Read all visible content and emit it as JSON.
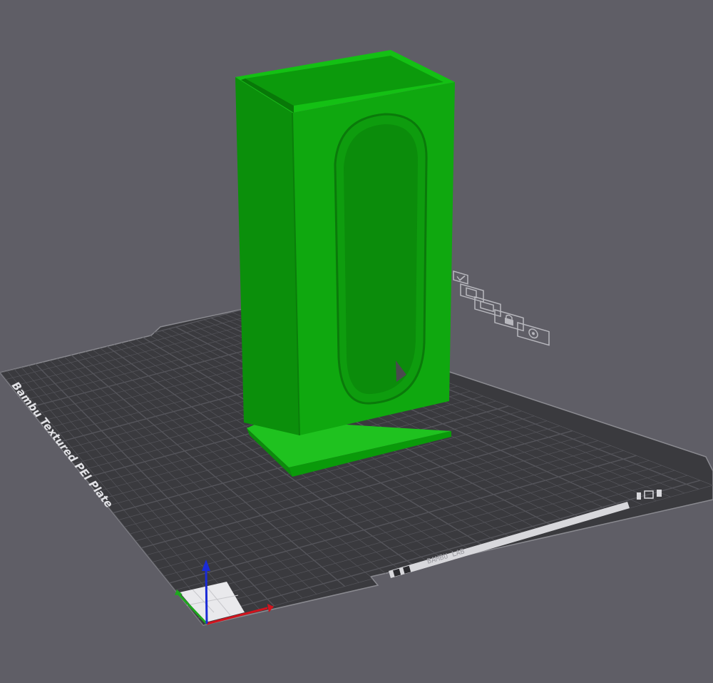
{
  "viewport": {
    "background_color": "#5f5e66",
    "plate": {
      "label": "Bambu Textured PEI Plate",
      "strip_text": "BAMBU LAB",
      "plate_color": "#3a3a3e",
      "grid_color": "#55555b",
      "edge_color": "#8a8a90",
      "marker_icons": [
        "checkbox-icon",
        "image-icon",
        "layers-icon",
        "lock-icon",
        "settings-icon"
      ]
    },
    "model": {
      "color_front": "#0fa80f",
      "color_side": "#0b8f0b",
      "color_top": "#12b812",
      "color_base": "#1fc21f"
    },
    "axes": {
      "x_color": "#d0141e",
      "y_color": "#1ea81e",
      "z_color": "#1a2bd6"
    }
  }
}
